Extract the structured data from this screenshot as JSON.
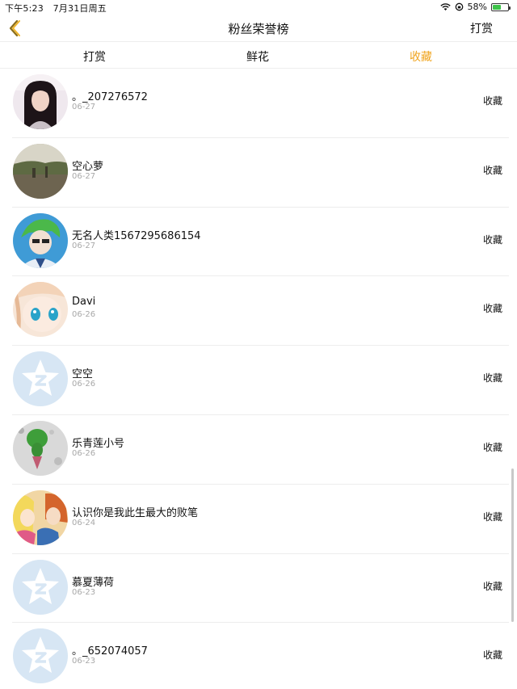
{
  "status_bar": {
    "time": "下午5:23",
    "date": "7月31日周五",
    "battery": "58%",
    "battery_level": 0.58
  },
  "nav": {
    "title": "粉丝荣誉榜",
    "right_label": "打赏"
  },
  "tabs": [
    {
      "label": "打赏",
      "active": false
    },
    {
      "label": "鲜花",
      "active": false
    },
    {
      "label": "收藏",
      "active": true
    }
  ],
  "fans": [
    {
      "name": "。_207276572",
      "date": "06-27",
      "action": "收藏",
      "avatar": "girl-photo"
    },
    {
      "name": "空心萝",
      "date": "06-27",
      "action": "收藏",
      "avatar": "landscape-photo"
    },
    {
      "name": "无名人类1567295686154",
      "date": "06-27",
      "action": "收藏",
      "avatar": "anime-green-hair"
    },
    {
      "name": "Davi",
      "date": "06-26",
      "action": "收藏",
      "avatar": "anime-girl"
    },
    {
      "name": "空空",
      "date": "06-26",
      "action": "收藏",
      "avatar": "default-star"
    },
    {
      "name": "乐青莲小号",
      "date": "06-26",
      "action": "收藏",
      "avatar": "green-figure"
    },
    {
      "name": "认识你是我此生最大的败笔",
      "date": "06-24",
      "action": "收藏",
      "avatar": "anime-group"
    },
    {
      "name": "慕夏薄荷",
      "date": "06-23",
      "action": "收藏",
      "avatar": "default-star"
    },
    {
      "name": "。_652074057",
      "date": "06-23",
      "action": "收藏",
      "avatar": "default-star"
    }
  ],
  "colors": {
    "accent": "#f0a41d",
    "divider": "#ededed",
    "muted": "#a8a8a8",
    "default_avatar": "#d7e6f4"
  }
}
